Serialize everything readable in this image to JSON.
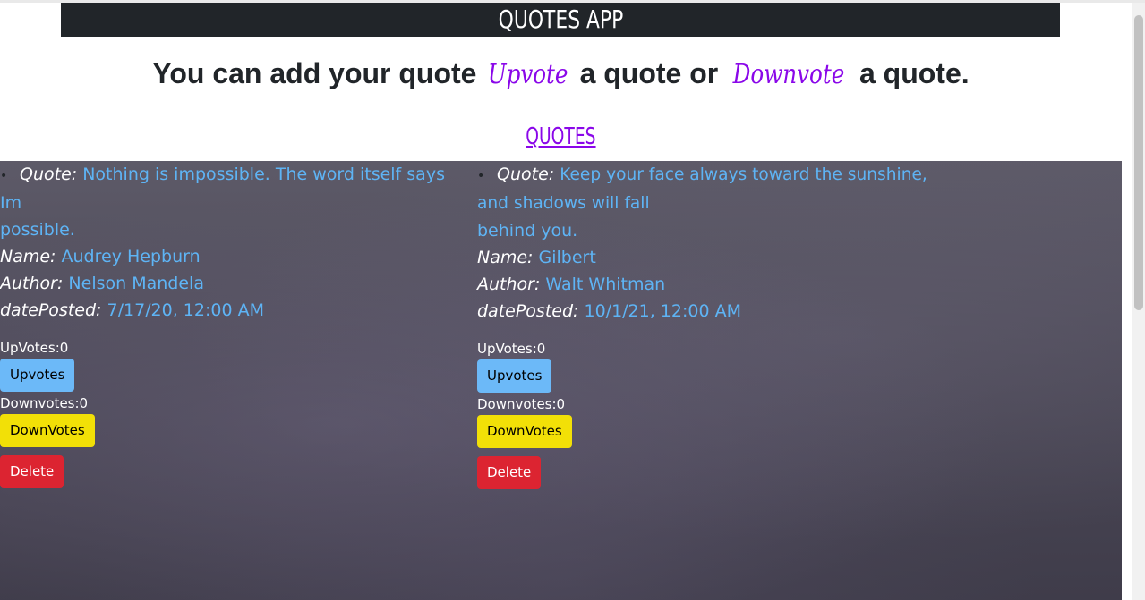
{
  "header": {
    "title": "QUOTES APP"
  },
  "intro": {
    "part1": "You can add your quote",
    "upvote_word": "Upvote",
    "part2": "a quote or",
    "downvote_word": "Downvote",
    "part3": "a quote."
  },
  "section": {
    "heading": "QUOTES"
  },
  "labels": {
    "quote": "Quote:",
    "name": "Name:",
    "author": "Author:",
    "date_posted": "datePosted:",
    "upvotes_prefix": "UpVotes:",
    "downvotes_prefix": "Downvotes:",
    "upvote_button": "Upvotes",
    "downvote_button": "DownVotes",
    "delete_button": "Delete"
  },
  "quotes": [
    {
      "quote_line1": "Nothing is impossible. The word itself says Im",
      "quote_line2": "possible.",
      "name": "Audrey Hepburn",
      "author": "Nelson Mandela",
      "date_posted": "7/17/20, 12:00 AM",
      "upvotes": "0",
      "downvotes": "0"
    },
    {
      "quote_line1": "Keep your face always toward the sunshine, and shadows will fall",
      "quote_line2": "behind you.",
      "name": "Gilbert",
      "author": "Walt Whitman",
      "date_posted": "10/1/21, 12:00 AM",
      "upvotes": "0",
      "downvotes": "0"
    }
  ],
  "colors": {
    "navbar": "#212529",
    "accent_purple": "#8a07e9",
    "value_blue": "#5eb4f5",
    "upvote_button": "#6cb9f8",
    "downvote_button": "#f2e007",
    "delete_button": "#dc2431"
  }
}
